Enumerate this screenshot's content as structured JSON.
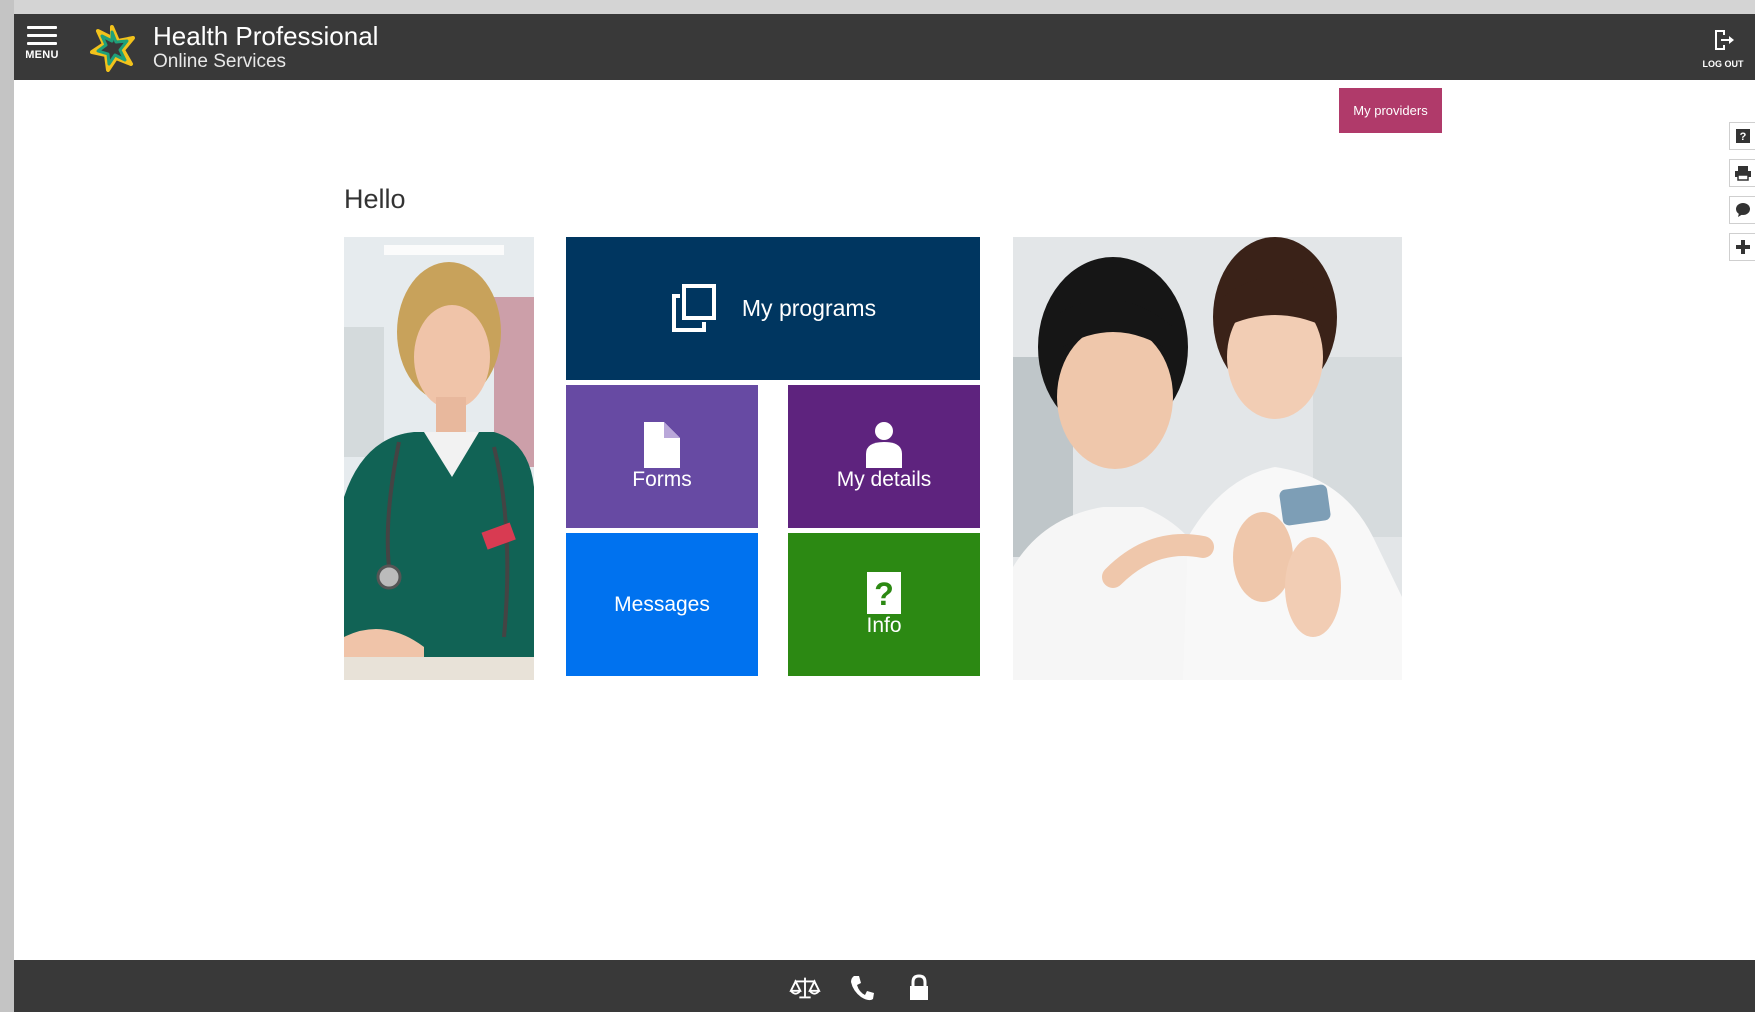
{
  "header": {
    "menu_label": "MENU",
    "brand_title": "Health Professional",
    "brand_subtitle": "Online Services",
    "logout_label": "LOG OUT"
  },
  "providers_button": "My providers",
  "greeting": "Hello",
  "tiles": {
    "programs": "My programs",
    "forms": "Forms",
    "details": "My details",
    "messages": "Messages",
    "info": "Info"
  },
  "side_tools": [
    "help-icon",
    "print-icon",
    "feedback-icon",
    "plus-icon"
  ],
  "footer_icons": [
    "scales-icon",
    "phone-icon",
    "lock-icon"
  ],
  "colors": {
    "header": "#393939",
    "providers": "#b03a6a",
    "programs": "#003660",
    "forms": "#674aa3",
    "details": "#5e237e",
    "messages": "#0072ef",
    "info": "#2c8913"
  }
}
